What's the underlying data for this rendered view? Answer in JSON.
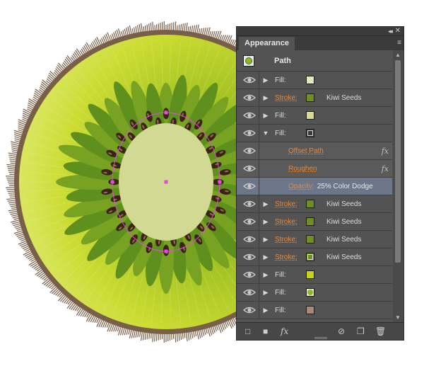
{
  "panel": {
    "tab_label": "Appearance",
    "object_label": "Path",
    "collapse_glyph": "◂◂",
    "close_glyph": "✕",
    "menu_glyph": "≡"
  },
  "rows": [
    {
      "label": "Fill:",
      "attr": "Fill",
      "swatch": "#d9e3a6",
      "swatch_style": "pattern"
    },
    {
      "label": "Stroke:",
      "attr": "Stroke",
      "swatch": "#6f8f23",
      "name": "Kiwi Seeds"
    },
    {
      "label": "Fill:",
      "attr": "Fill",
      "swatch": "#d6db9a"
    },
    {
      "label": "Fill:",
      "attr": "Fill",
      "swatch": "#3a3a3a",
      "swatch_style": "boxed",
      "expanded": true
    },
    {
      "effect": "Offset Path",
      "has_fx": true
    },
    {
      "effect": "Roughen",
      "has_fx": true
    },
    {
      "opacity_label": "Opacity:",
      "opacity_value": "25% Color Dodge",
      "selected": true
    },
    {
      "label": "Stroke:",
      "attr": "Stroke",
      "swatch": "#6f8f23",
      "name": "Kiwi Seeds"
    },
    {
      "label": "Stroke:",
      "attr": "Stroke",
      "swatch": "#6f8f23",
      "name": "Kiwi Seeds"
    },
    {
      "label": "Stroke:",
      "attr": "Stroke",
      "swatch": "#6f8f23",
      "name": "Kiwi Seeds"
    },
    {
      "label": "Stroke:",
      "attr": "Stroke",
      "swatch": "#6f8f23",
      "swatch_style": "boxed",
      "name": "Kiwi Seeds"
    },
    {
      "label": "Fill:",
      "attr": "Fill",
      "swatch": "#c9d21b"
    },
    {
      "label": "Fill:",
      "attr": "Fill",
      "swatch": "#8fb52a",
      "swatch_style": "circle"
    },
    {
      "label": "Fill:",
      "attr": "Fill",
      "swatch": "#a68a7a"
    }
  ],
  "bottom_toolbar": {
    "add_stroke": "□",
    "add_fill": "■",
    "fx": "fx",
    "clear": "⊘",
    "duplicate": "❐",
    "delete": "🗑"
  },
  "colors": {
    "kiwi_rim": "#7a5f48",
    "kiwi_flesh_outer": "#c7dc2a",
    "kiwi_flesh_inner": "#8fb030",
    "kiwi_ring": "#5f8f1c",
    "kiwi_core": "#d1d993",
    "seed": "#3b2214",
    "selection": "#e34ce0"
  }
}
